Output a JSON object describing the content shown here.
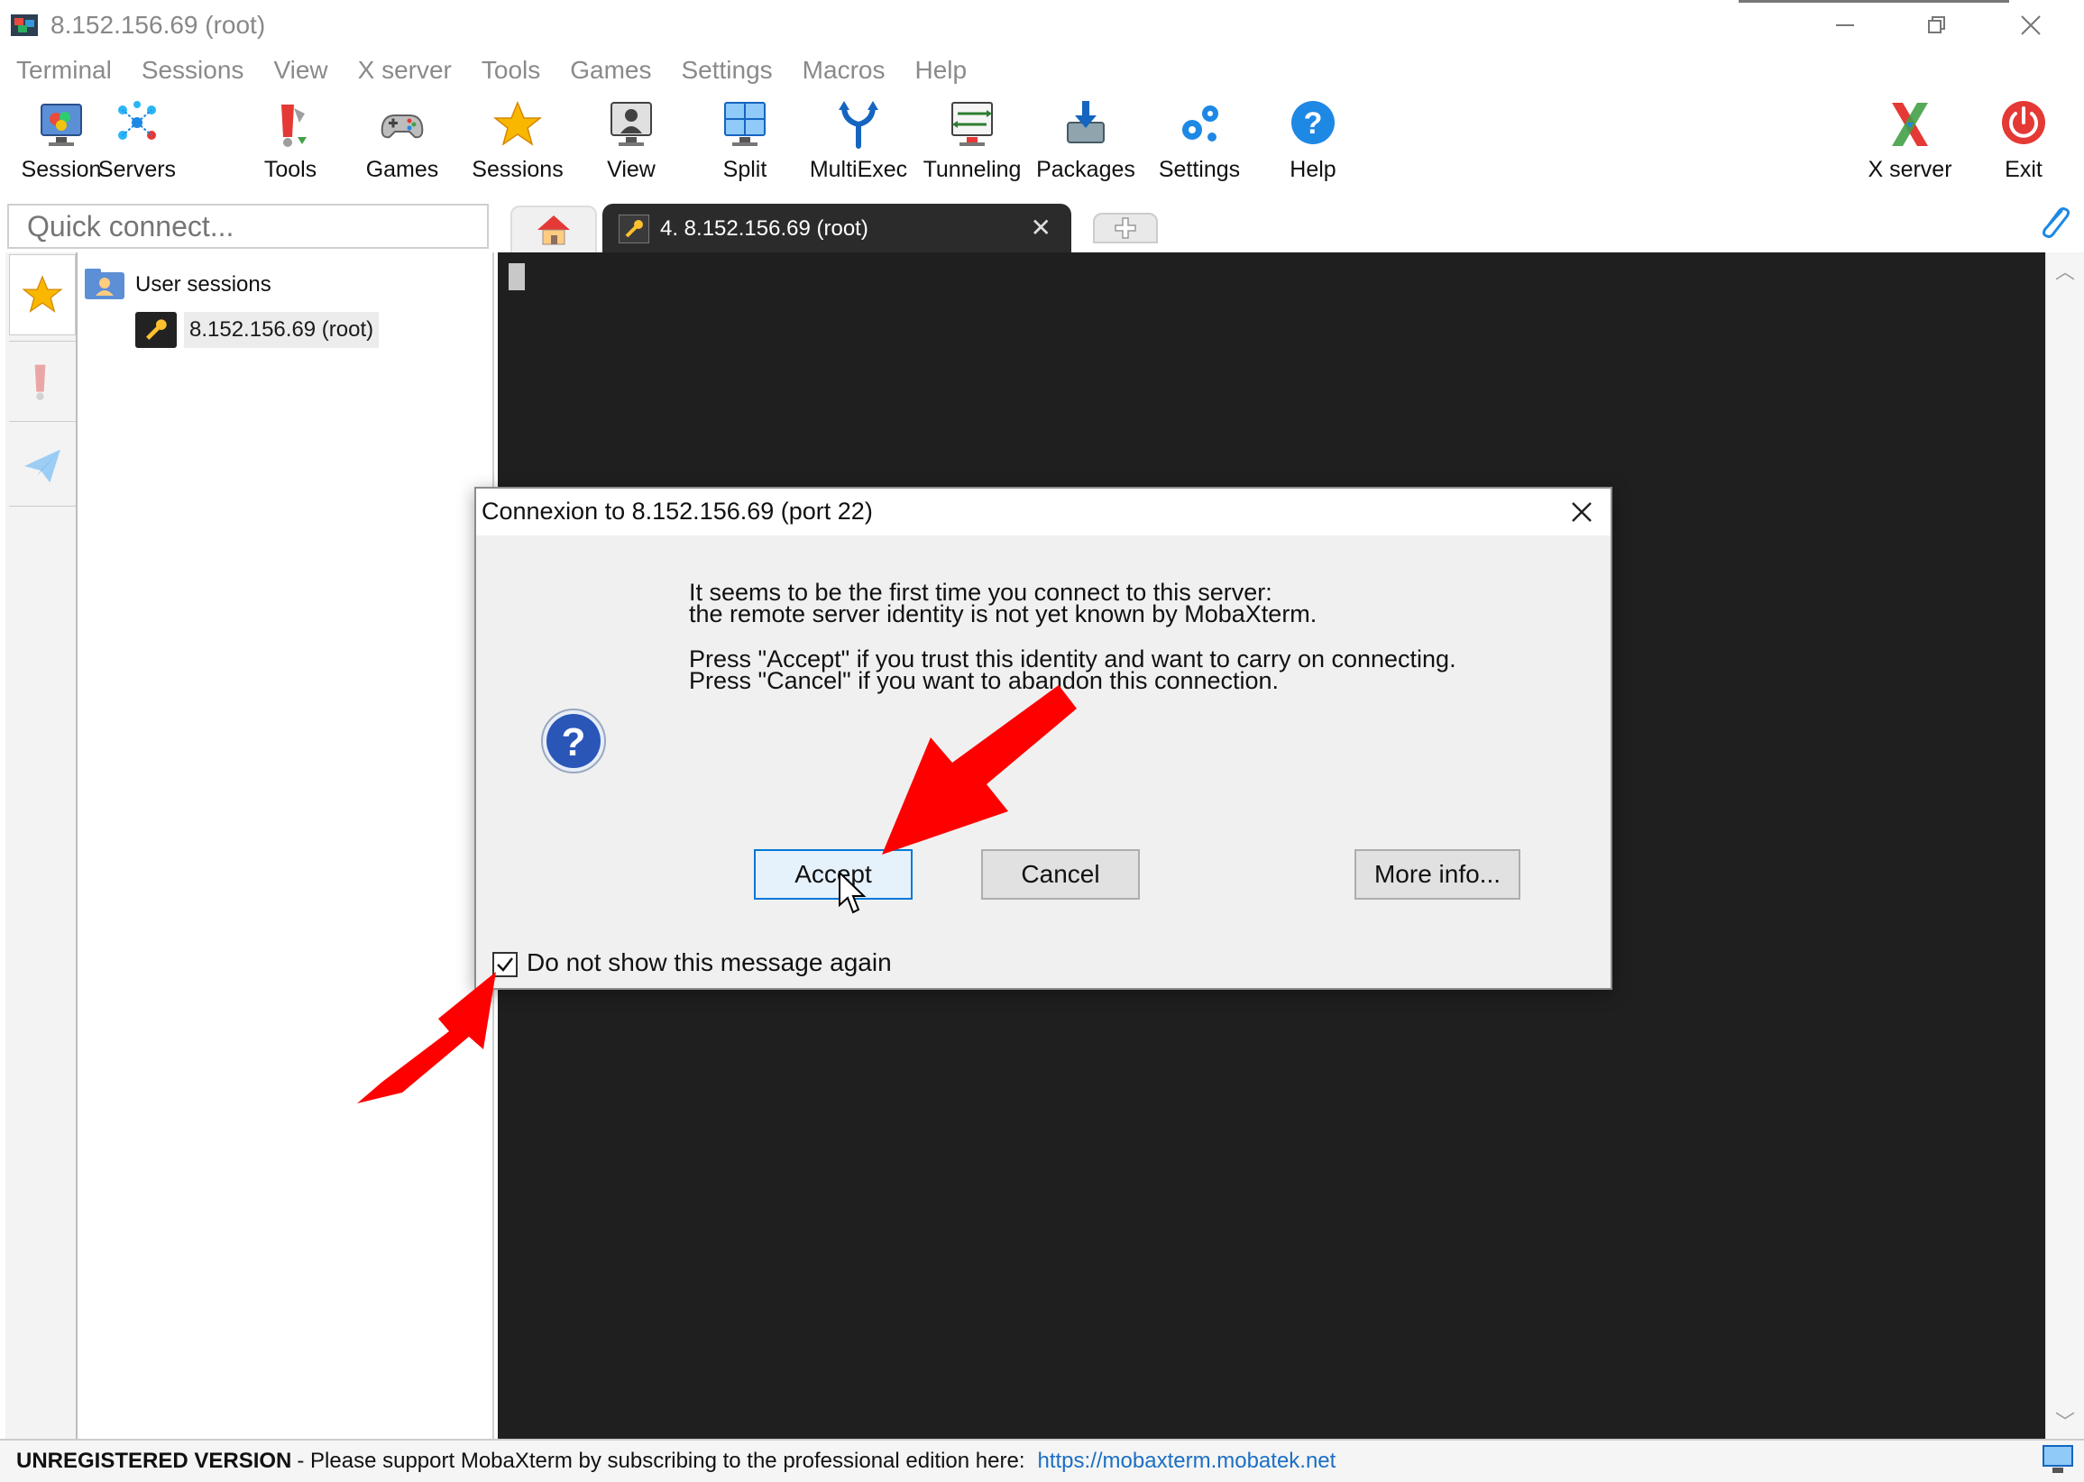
{
  "window": {
    "title": "8.152.156.69 (root)",
    "controls": [
      "minimize",
      "restore",
      "close"
    ]
  },
  "menu": [
    "Terminal",
    "Sessions",
    "View",
    "X server",
    "Tools",
    "Games",
    "Settings",
    "Macros",
    "Help"
  ],
  "toolbar": {
    "items": [
      {
        "label": "Session",
        "icon": "session-icon"
      },
      {
        "label": "Servers",
        "icon": "servers-icon"
      },
      {
        "label": "Tools",
        "icon": "tools-icon"
      },
      {
        "label": "Games",
        "icon": "gamepad-icon"
      },
      {
        "label": "Sessions",
        "icon": "star-icon"
      },
      {
        "label": "View",
        "icon": "view-icon"
      },
      {
        "label": "Split",
        "icon": "split-icon"
      },
      {
        "label": "MultiExec",
        "icon": "fork-icon"
      },
      {
        "label": "Tunneling",
        "icon": "tunneling-icon"
      },
      {
        "label": "Packages",
        "icon": "packages-icon"
      },
      {
        "label": "Settings",
        "icon": "gears-icon"
      },
      {
        "label": "Help",
        "icon": "help-icon"
      }
    ],
    "right_items": [
      {
        "label": "X server",
        "icon": "x-server-icon"
      },
      {
        "label": "Exit",
        "icon": "power-icon"
      }
    ]
  },
  "quick_connect": {
    "placeholder": "Quick connect..."
  },
  "tabs": {
    "active_label": "4. 8.152.156.69 (root)"
  },
  "sessions_tree": {
    "root_label": "User sessions",
    "items": [
      {
        "label": "8.152.156.69 (root)"
      }
    ]
  },
  "dialog": {
    "title": "Connexion to 8.152.156.69 (port 22)",
    "line1": "It seems to be the first time you connect to this server:",
    "line2": "the remote server identity is not yet known by MobaXterm.",
    "line3": "Press \"Accept\" if you trust this identity and want to carry on connecting.",
    "line4": "Press \"Cancel\" if you want to abandon this connection.",
    "accept_label": "Accept",
    "cancel_label": "Cancel",
    "more_info_label": "More info...",
    "checkbox_label": "Do not show this message again",
    "checkbox_checked": true
  },
  "statusbar": {
    "bold": "UNREGISTERED VERSION",
    "text": " -  Please support MobaXterm by subscribing to the professional edition here:",
    "link": "https://mobaxterm.mobatek.net"
  },
  "colors": {
    "terminal_bg": "#1f1f1f",
    "annotation_arrow": "#ff0000",
    "link": "#1b6fc4",
    "accept_border": "#0078d7"
  }
}
